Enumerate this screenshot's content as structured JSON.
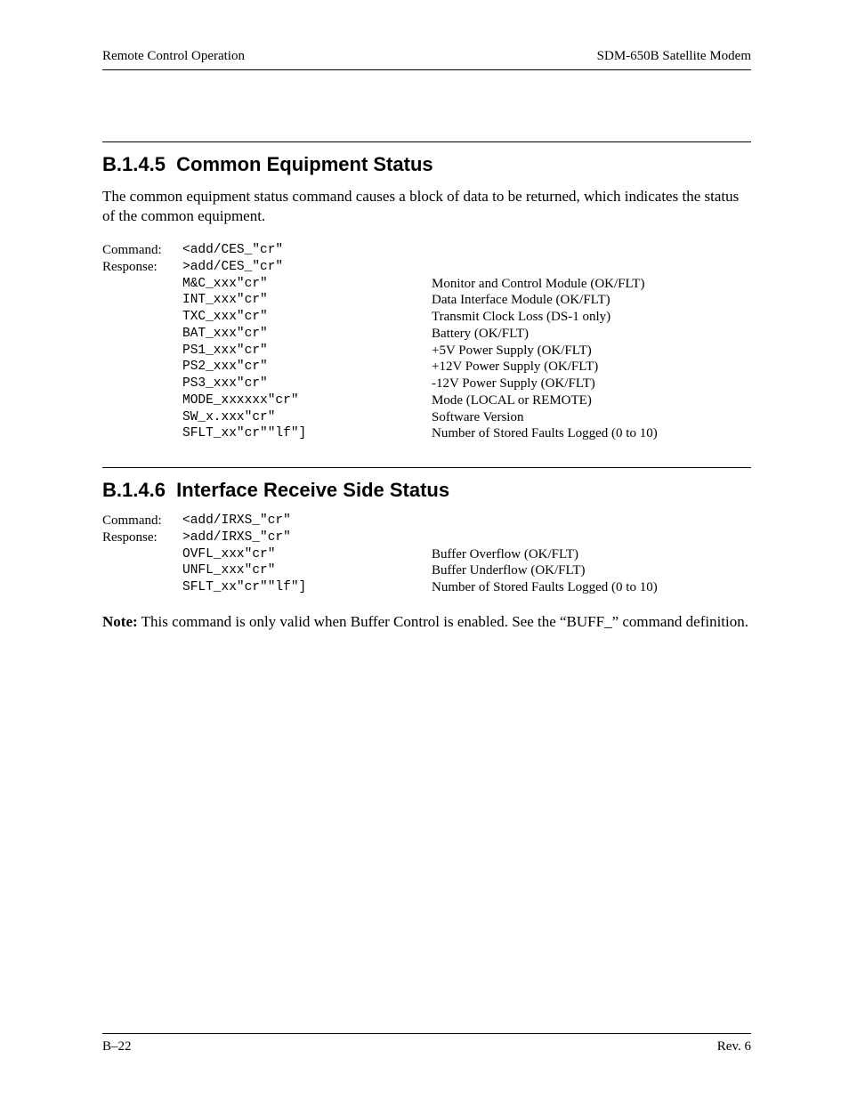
{
  "header": {
    "left": "Remote Control Operation",
    "right": "SDM-650B Satellite Modem"
  },
  "section1": {
    "number": "B.1.4.5",
    "title": "Common Equipment Status",
    "intro": "The common equipment status command causes a block of data to be returned, which indicates the status of the common equipment.",
    "labels": {
      "command": "Command:",
      "response": "Response:"
    },
    "command_code": "<add/CES_\"cr\"",
    "response_code": ">add/CES_\"cr\"",
    "rows": [
      {
        "code": "M&C_xxx\"cr\"",
        "desc": "Monitor and Control Module (OK/FLT)"
      },
      {
        "code": "INT_xxx\"cr\"",
        "desc": "Data Interface Module (OK/FLT)"
      },
      {
        "code": "TXC_xxx\"cr\"",
        "desc": "Transmit Clock Loss (DS-1 only)"
      },
      {
        "code": "BAT_xxx\"cr\"",
        "desc": "Battery (OK/FLT)"
      },
      {
        "code": "PS1_xxx\"cr\"",
        "desc": "+5V Power Supply (OK/FLT)"
      },
      {
        "code": "PS2_xxx\"cr\"",
        "desc": "+12V Power Supply (OK/FLT)"
      },
      {
        "code": "PS3_xxx\"cr\"",
        "desc": "-12V Power Supply (OK/FLT)"
      },
      {
        "code": "MODE_xxxxxx\"cr\"",
        "desc": "Mode (LOCAL or REMOTE)"
      },
      {
        "code": "SW_x.xxx\"cr\"",
        "desc": "Software Version"
      },
      {
        "code": "SFLT_xx\"cr\"\"lf\"]",
        "desc": "Number of Stored Faults Logged (0 to 10)"
      }
    ]
  },
  "section2": {
    "number": "B.1.4.6",
    "title": "Interface Receive Side Status",
    "labels": {
      "command": "Command:",
      "response": "Response:"
    },
    "command_code": "<add/IRXS_\"cr\"",
    "response_code": ">add/IRXS_\"cr\"",
    "rows": [
      {
        "code": "OVFL_xxx\"cr\"",
        "desc": "Buffer Overflow (OK/FLT)"
      },
      {
        "code": "UNFL_xxx\"cr\"",
        "desc": "Buffer Underflow (OK/FLT)"
      },
      {
        "code": "SFLT_xx\"cr\"\"lf\"]",
        "desc": "Number of Stored Faults Logged (0 to 10)"
      }
    ],
    "note_label": "Note:",
    "note_text": " This command is only valid when Buffer Control is enabled. See the “BUFF_” command definition."
  },
  "footer": {
    "left": "B–22",
    "right": "Rev. 6"
  }
}
